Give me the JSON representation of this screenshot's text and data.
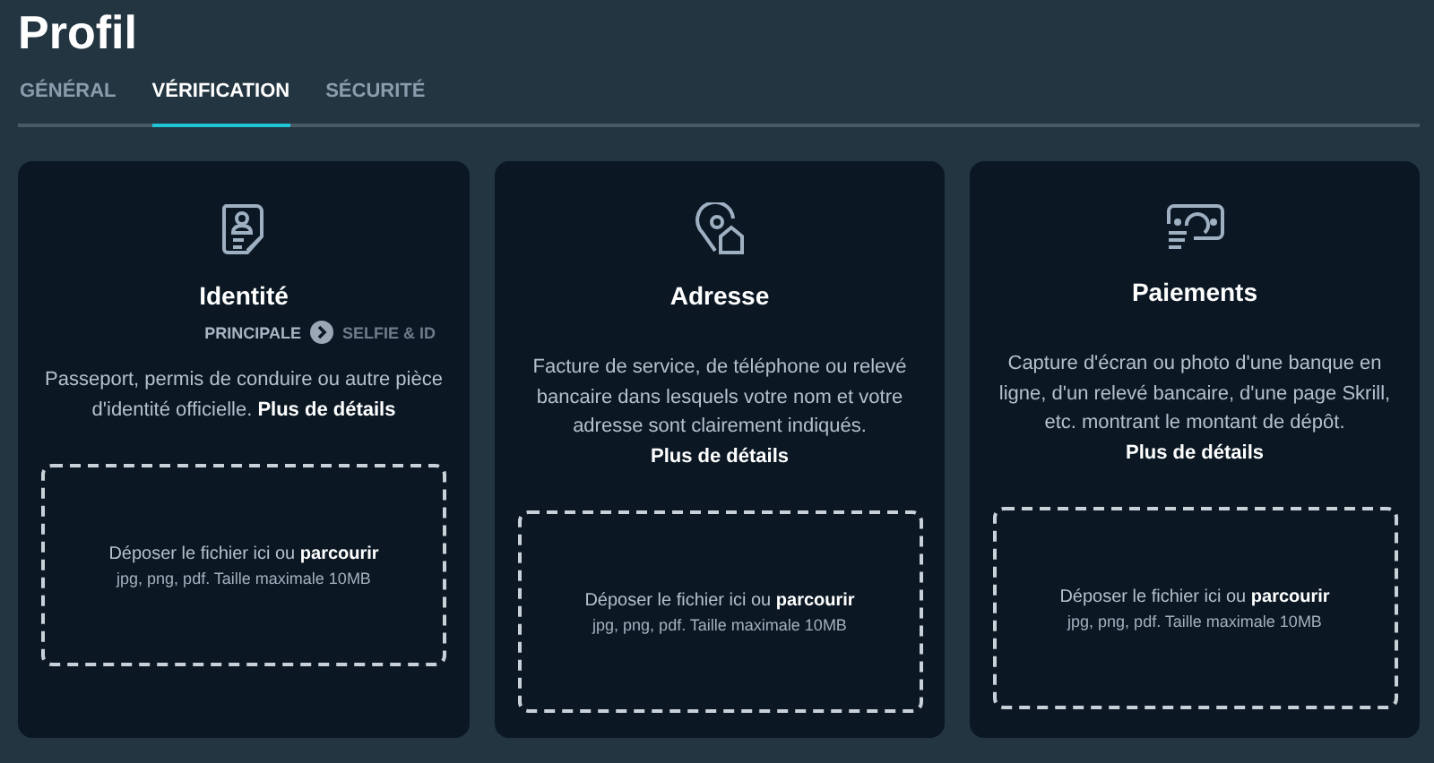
{
  "page_title": "Profil",
  "tabs": [
    {
      "label": "GÉNÉRAL",
      "selected": false
    },
    {
      "label": "VÉRIFICATION",
      "selected": true
    },
    {
      "label": "SÉCURITÉ",
      "selected": false
    }
  ],
  "cards": [
    {
      "kind": "identity",
      "title": "Identité",
      "steps": [
        {
          "label": "PRINCIPALE",
          "selected": true
        },
        {
          "label": "SELFIE & ID",
          "selected": false
        }
      ],
      "description": "Passeport, permis de conduire ou autre pièce d'identité officielle.",
      "link": "Plus de détails",
      "drop_text": "Déposer le fichier ici ou",
      "browse_link": "parcourir",
      "hint": "jpg, png, pdf. Taille maximale 10MB"
    },
    {
      "kind": "address",
      "title": "Adresse",
      "description": "Facture de service, de téléphone ou relevé bancaire dans lesquels votre nom et votre adresse sont clairement indiqués.",
      "link": "Plus de détails",
      "drop_text": "Déposer le fichier ici ou",
      "browse_link": "parcourir",
      "hint": "jpg, png, pdf. Taille maximale 10MB"
    },
    {
      "kind": "payment",
      "title": "Paiements",
      "description": "Capture d'écran ou photo d'une banque en ligne, d'un relevé bancaire, d'une page Skrill, etc. montrant le montant de dépôt.",
      "link": "Plus de détails",
      "drop_text": "Déposer le fichier ici ou",
      "browse_link": "parcourir",
      "hint": "jpg, png, pdf. Taille maximale 10MB"
    }
  ]
}
